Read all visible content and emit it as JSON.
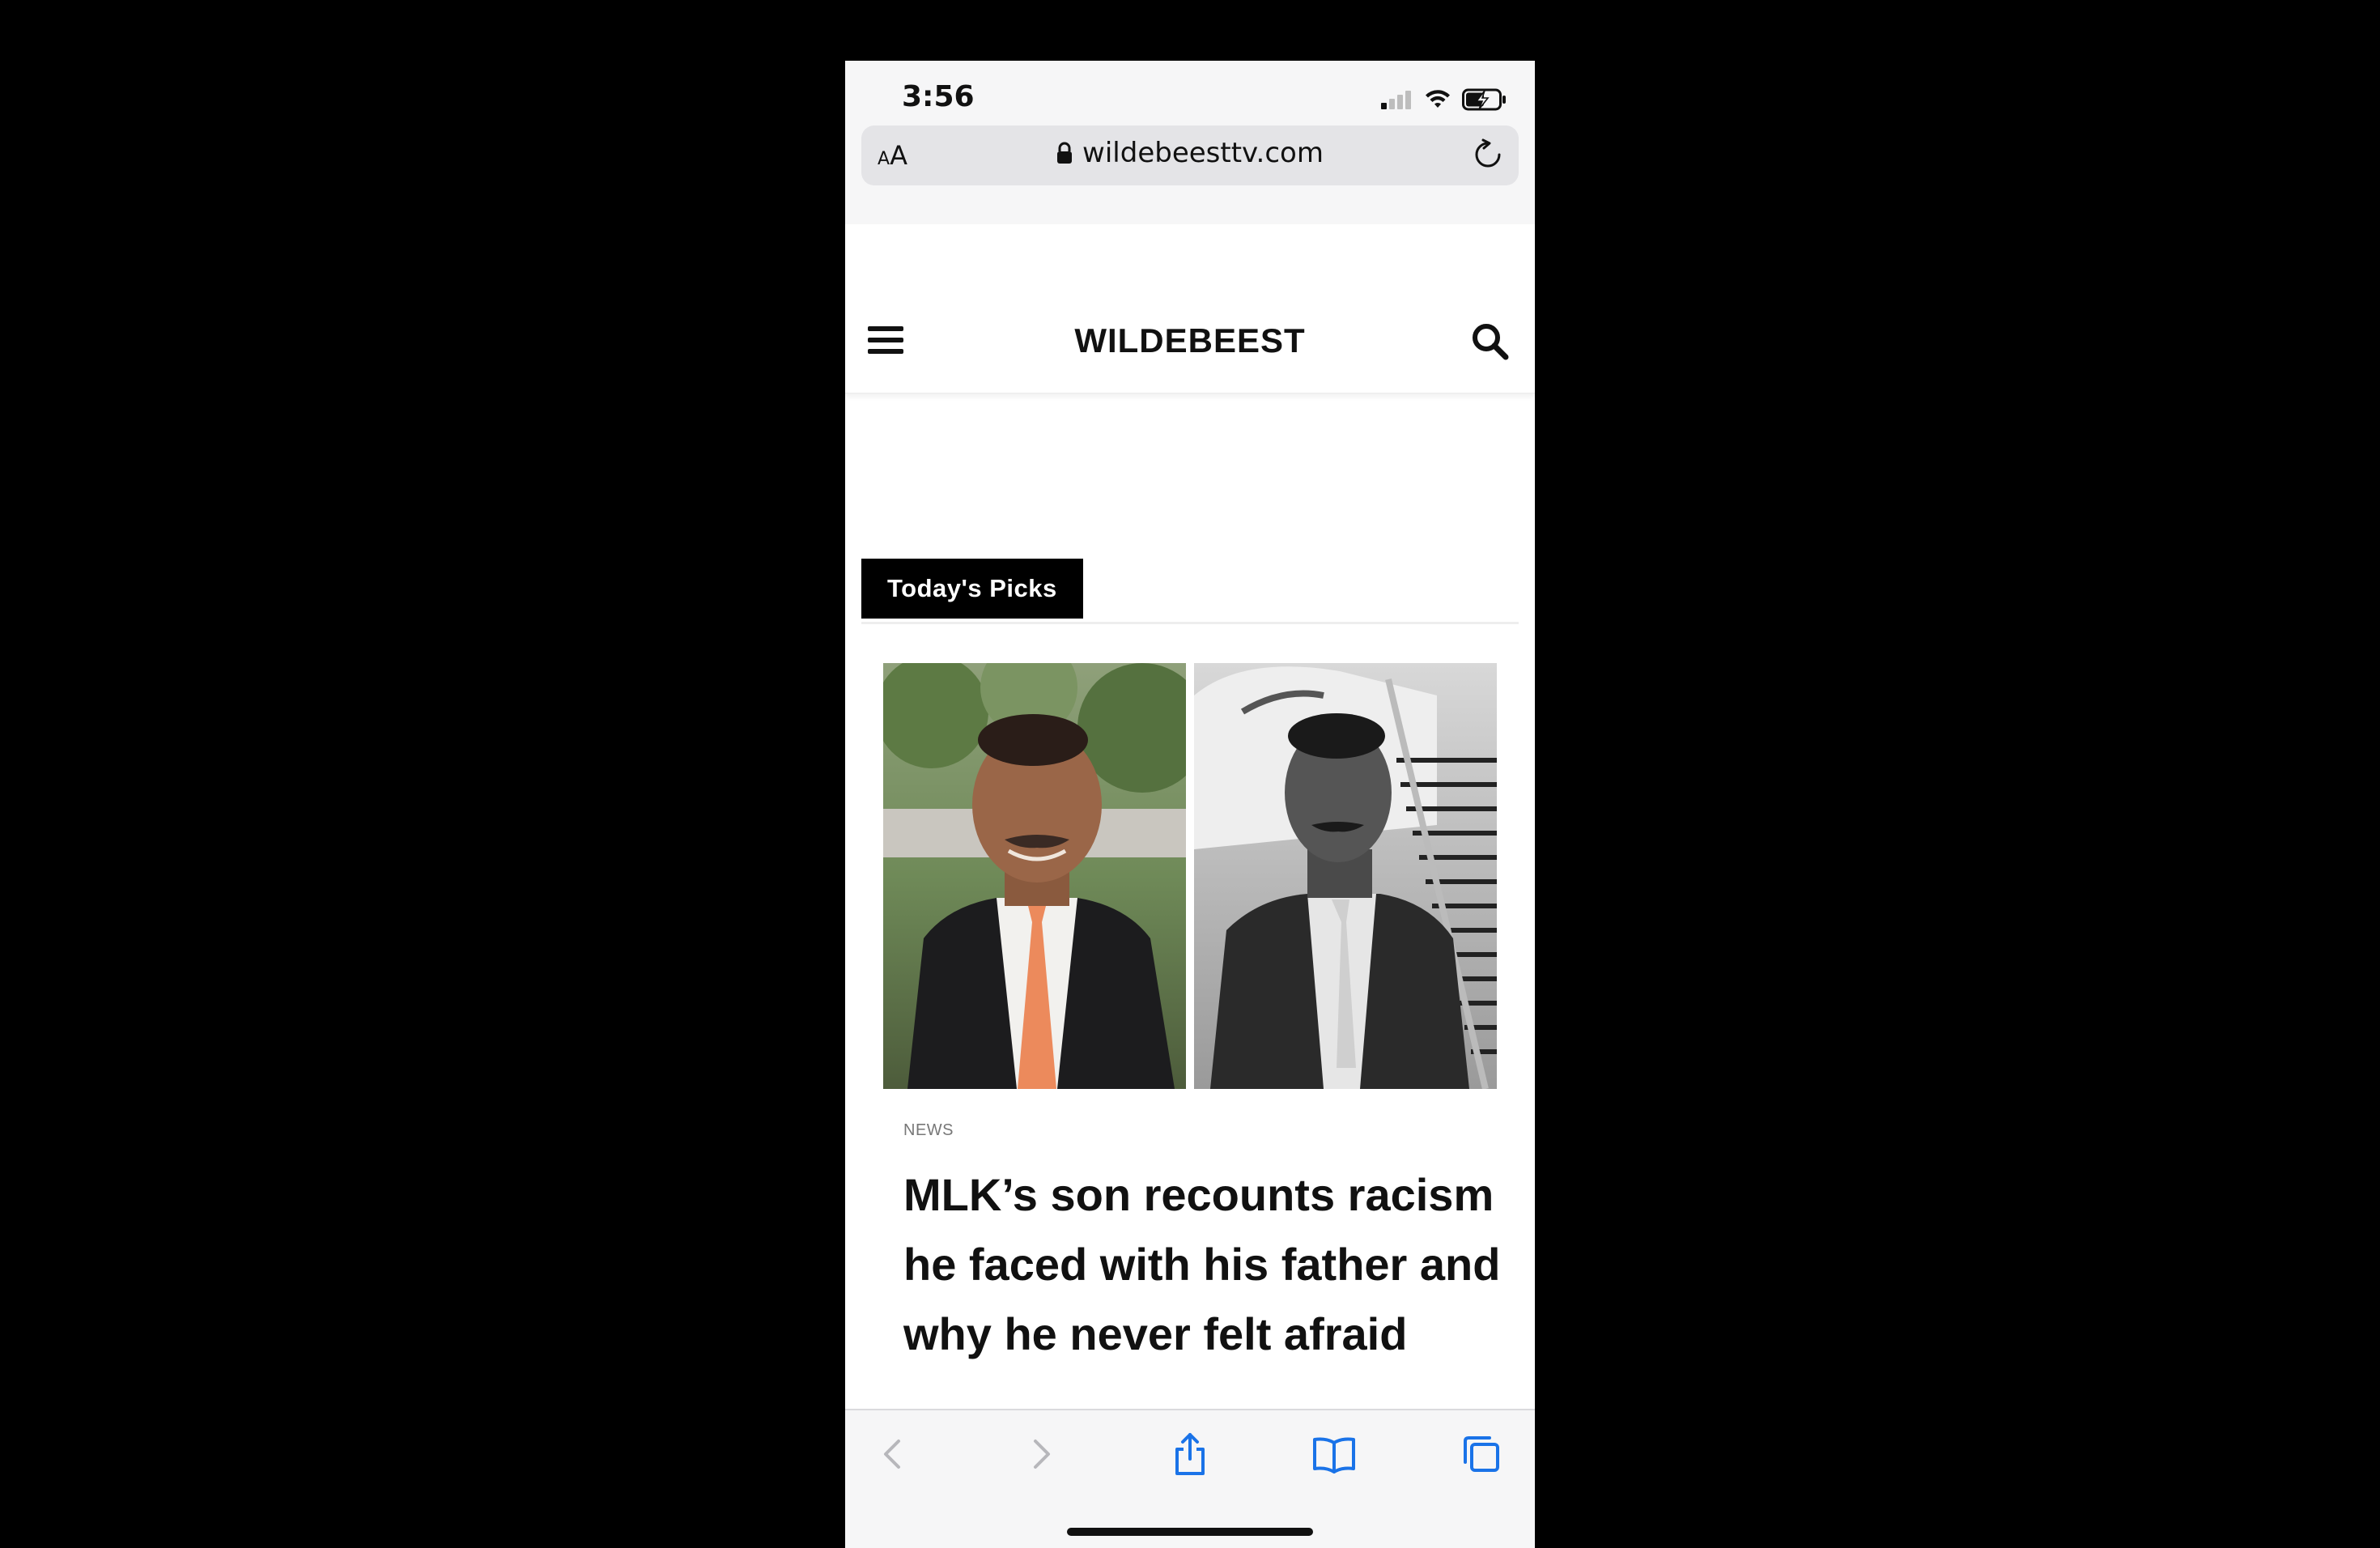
{
  "status": {
    "time": "3:56"
  },
  "browser": {
    "text_size_label_small": "A",
    "text_size_label_large": "A",
    "url": "wildebeesttv.com"
  },
  "site": {
    "logo": "WILDEBEEST"
  },
  "content": {
    "section_tab": "Today's Picks",
    "article": {
      "category": "NEWS",
      "headline": "MLK’s son recounts racism he faced with his father and why he never felt afraid"
    }
  },
  "icons": {
    "status": [
      "cellular-signal-icon",
      "wifi-icon",
      "battery-charging-icon"
    ],
    "toolbar": [
      "back-icon",
      "forward-icon",
      "share-icon",
      "bookmarks-icon",
      "tabs-icon"
    ]
  },
  "colors": {
    "section_tab_bg": "#000000",
    "browser_chrome": "#f6f6f7",
    "toolbar_active": "#1a73e8",
    "toolbar_disabled": "#b7b7bb"
  }
}
